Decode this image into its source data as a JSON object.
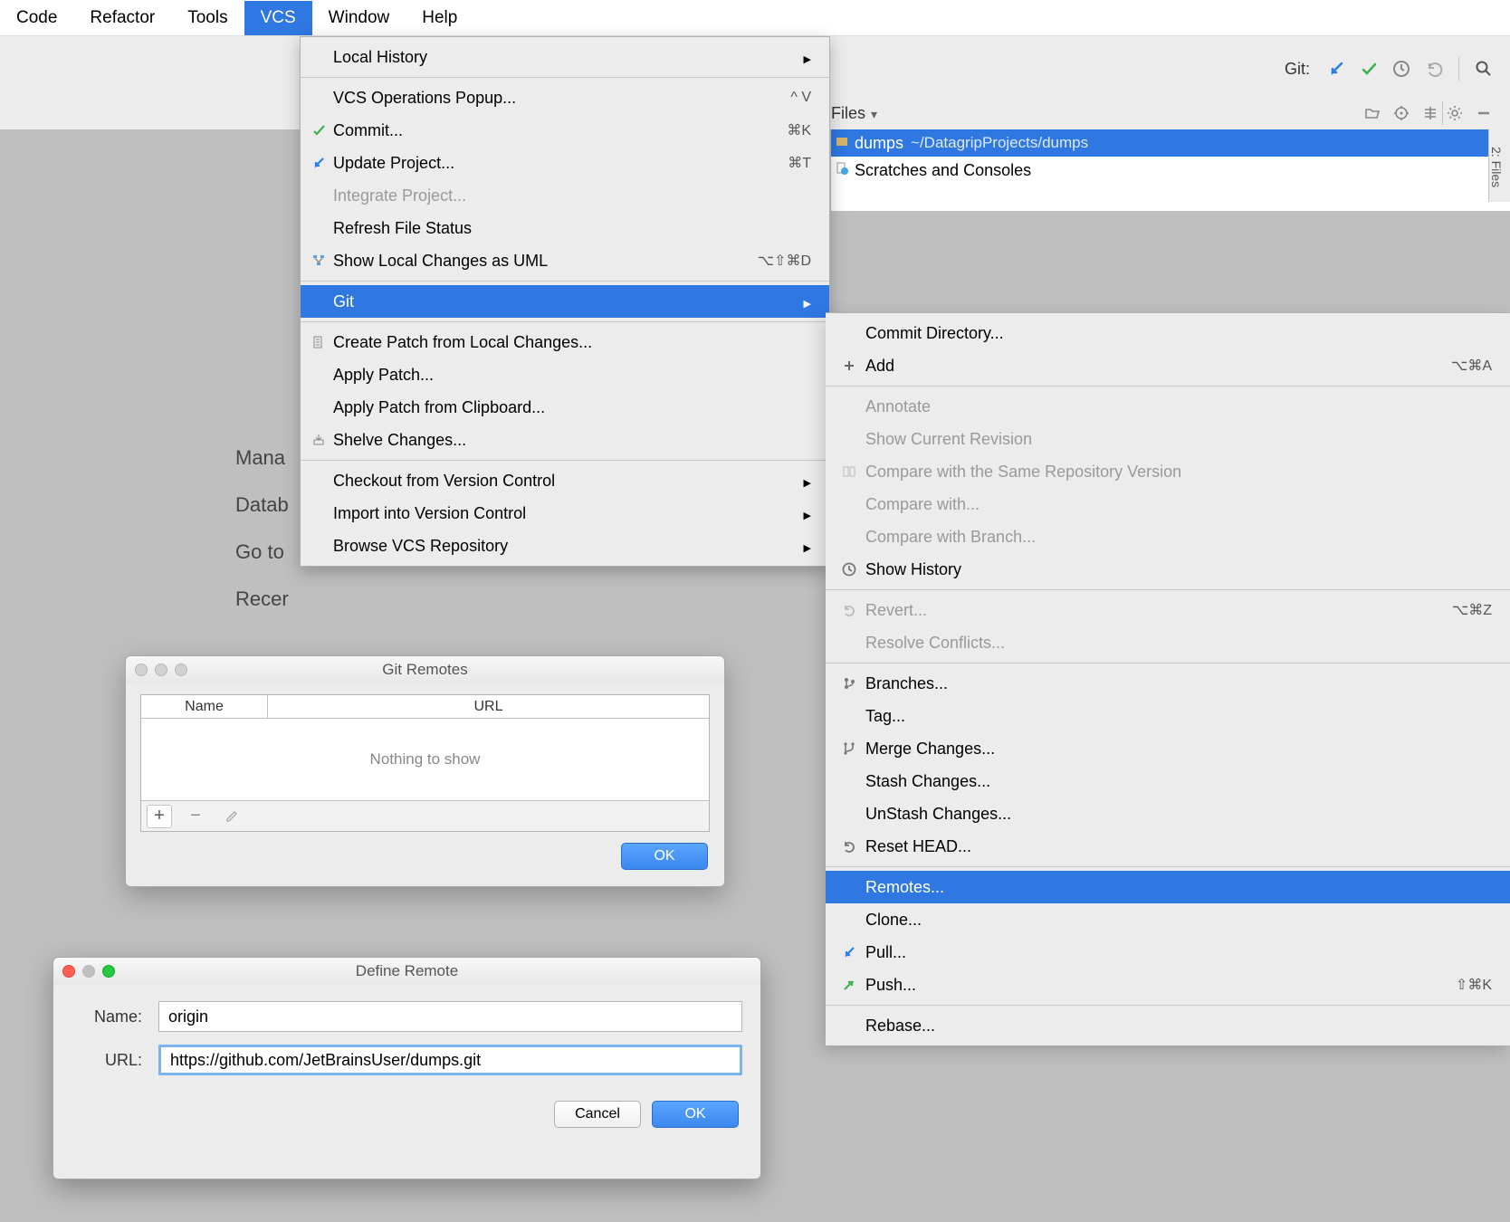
{
  "menubar": {
    "items": [
      "Code",
      "Refactor",
      "Tools",
      "VCS",
      "Window",
      "Help"
    ],
    "active_index": 3
  },
  "toolbar": {
    "git_label": "Git:"
  },
  "panel": {
    "label": "Files"
  },
  "project_tree": {
    "root": {
      "name": "dumps",
      "path": "~/DatagripProjects/dumps"
    },
    "scratches": "Scratches and Consoles"
  },
  "sidetab": "2: Files",
  "welcome": {
    "l0": "Mana",
    "l1": "Datab",
    "l2": "Go to",
    "l3": "Recer"
  },
  "vcs_menu": {
    "local_history": "Local History",
    "vcs_ops_popup": "VCS Operations Popup...",
    "vcs_ops_popup_sc": "^ V",
    "commit": "Commit...",
    "commit_sc": "⌘K",
    "update_project": "Update Project...",
    "update_project_sc": "⌘T",
    "integrate_project": "Integrate Project...",
    "refresh_file_status": "Refresh File Status",
    "show_local_changes_uml": "Show Local Changes as UML",
    "show_local_changes_uml_sc": "⌥⇧⌘D",
    "git": "Git",
    "create_patch": "Create Patch from Local Changes...",
    "apply_patch": "Apply Patch...",
    "apply_patch_clipboard": "Apply Patch from Clipboard...",
    "shelve_changes": "Shelve Changes...",
    "checkout_from_vc": "Checkout from Version Control",
    "import_into_vc": "Import into Version Control",
    "browse_vcs_repo": "Browse VCS Repository"
  },
  "git_menu": {
    "commit_dir": "Commit Directory...",
    "add": "Add",
    "add_sc": "⌥⌘A",
    "annotate": "Annotate",
    "show_current_rev": "Show Current Revision",
    "compare_same_repo": "Compare with the Same Repository Version",
    "compare_with": "Compare with...",
    "compare_branch": "Compare with Branch...",
    "show_history": "Show History",
    "revert": "Revert...",
    "revert_sc": "⌥⌘Z",
    "resolve_conflicts": "Resolve Conflicts...",
    "branches": "Branches...",
    "tag": "Tag...",
    "merge_changes": "Merge Changes...",
    "stash_changes": "Stash Changes...",
    "unstash_changes": "UnStash Changes...",
    "reset_head": "Reset HEAD...",
    "remotes": "Remotes...",
    "clone": "Clone...",
    "pull": "Pull...",
    "push": "Push...",
    "push_sc": "⇧⌘K",
    "rebase": "Rebase..."
  },
  "remotes_dialog": {
    "title": "Git Remotes",
    "col_name": "Name",
    "col_url": "URL",
    "empty": "Nothing to show",
    "ok": "OK"
  },
  "define_dialog": {
    "title": "Define Remote",
    "name_label": "Name:",
    "name_value": "origin",
    "url_label": "URL:",
    "url_value": "https://github.com/JetBrainsUser/dumps.git",
    "cancel": "Cancel",
    "ok": "OK"
  }
}
